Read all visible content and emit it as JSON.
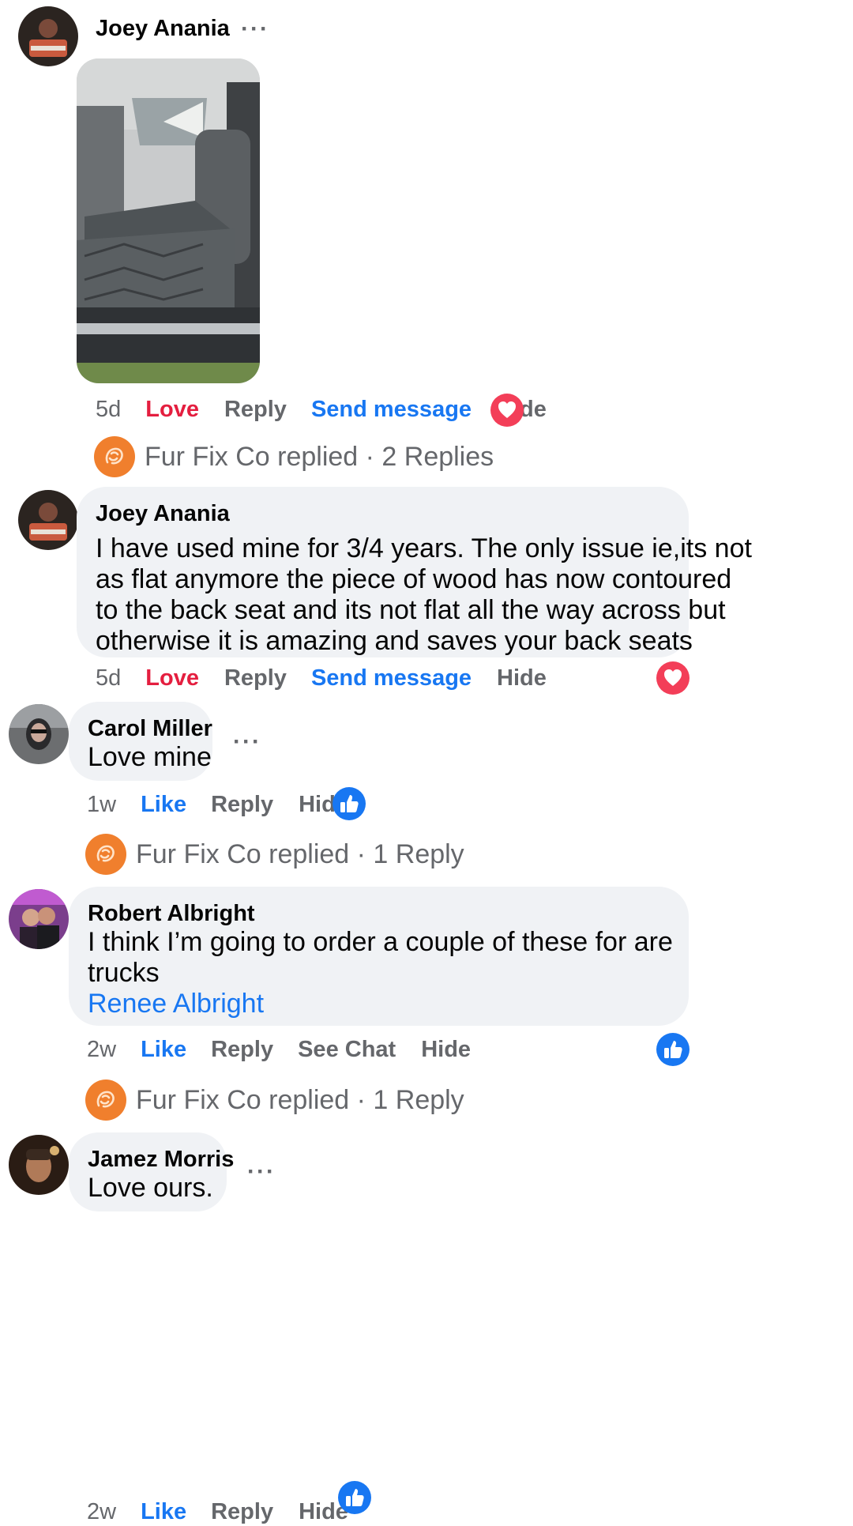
{
  "comments": [
    {
      "author": "Joey Anania",
      "more": "···",
      "time": "5d",
      "action1": "Love",
      "action2": "Reply",
      "action3": "Send message",
      "action4": "Hide",
      "reaction_icon": "heart-icon",
      "photo_alt": "truck back seat with seat cover"
    },
    {
      "author": "Joey Anania",
      "lines": [
        "I have used mine for 3/4 years. The only issue ie,its not",
        "as flat anymore the piece of wood has now contoured",
        "to the back seat and its not flat all the way across but",
        "otherwise it is amazing and saves your back seats"
      ],
      "time": "5d",
      "action1": "Love",
      "action2": "Reply",
      "action3": "Send message",
      "action4": "Hide",
      "reaction_icon": "heart-icon"
    },
    {
      "author": "Carol Miller",
      "text": "Love mine",
      "more": "···",
      "time": "1w",
      "action1": "Like",
      "action2": "Reply",
      "action3": "Hide",
      "reaction_icon": "thumbs-up-icon"
    },
    {
      "author": "Robert Albright",
      "lines": [
        "I think I’m going to order a couple of these for are",
        "trucks"
      ],
      "mention": "Renee Albright",
      "time": "2w",
      "action1": "Like",
      "action2": "Reply",
      "action3": "See Chat",
      "action4": "Hide",
      "reaction_icon": "thumbs-up-icon"
    },
    {
      "author": "Jamez Morris",
      "text": "Love ours.",
      "more": "···",
      "time": "2w",
      "action1": "Like",
      "action2": "Reply",
      "action3": "Hide",
      "reaction_icon": "thumbs-up-icon"
    }
  ],
  "replies": [
    {
      "label": "Fur Fix Co replied · 2 Replies"
    },
    {
      "label": "Fur Fix Co replied · 1 Reply"
    },
    {
      "label": "Fur Fix Co replied · 1 Reply"
    }
  ],
  "colors": {
    "love": "#e41e3f",
    "like": "#1877f2",
    "muted": "#65676b",
    "bubble": "#f0f2f5",
    "page_avatar": "#f07f2d"
  }
}
